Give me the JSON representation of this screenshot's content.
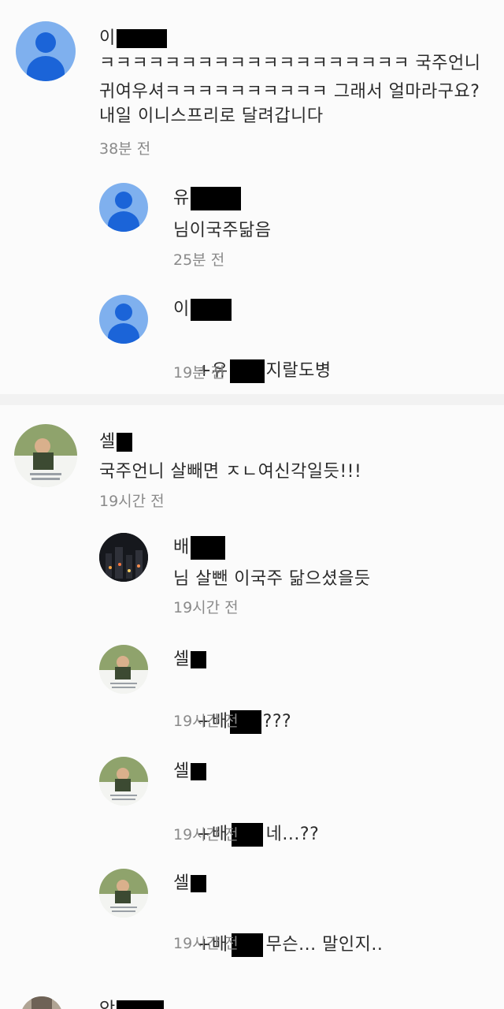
{
  "comments": [
    {
      "author_visible": "이",
      "lines": [
        "ㅋㅋㅋㅋㅋㅋㅋㅋㅋㅋㅋㅋㅋㅋㅋㅋㅋㅋㅋ 국주언니",
        "귀여우셔ㅋㅋㅋㅋㅋㅋㅋㅋㅋㅋ 그래서 얼마라구요?",
        "내일 이니스프리로 달려갑니다"
      ],
      "time": "38분 전",
      "avatar": "default-avatar"
    },
    {
      "author_visible": "유",
      "lines": [
        "님이국주닮음"
      ],
      "time": "25분 전",
      "avatar": "default-avatar"
    },
    {
      "author_visible": "이",
      "mention_prefix": "+유",
      "mention_suffix": "지랄도병",
      "time": "19분 전",
      "avatar": "default-avatar"
    },
    {
      "author_visible": "셀",
      "lines": [
        "국주언니 살빼면 ㅈㄴ여신각일듯!!!"
      ],
      "time": "19시간 전",
      "avatar": "photo-avatar"
    },
    {
      "author_visible": "배",
      "lines": [
        "님 살뺀 이국주 닮으셨을듯"
      ],
      "time": "19시간 전",
      "avatar": "night-photo-avatar"
    },
    {
      "author_visible": "셀",
      "mention_prefix": "+배",
      "mention_suffix": "???",
      "time": "19시간 전",
      "avatar": "photo-avatar"
    },
    {
      "author_visible": "셀",
      "mention_prefix": "+배",
      "mention_suffix": "네...??",
      "time": "19시간 전",
      "avatar": "photo-avatar"
    },
    {
      "author_visible": "셀",
      "mention_prefix": "+배",
      "mention_suffix": "무슨... 말인지..",
      "time": "19시간 전",
      "avatar": "photo-avatar"
    },
    {
      "author_visible": "안",
      "avatar": "photo-avatar"
    }
  ]
}
